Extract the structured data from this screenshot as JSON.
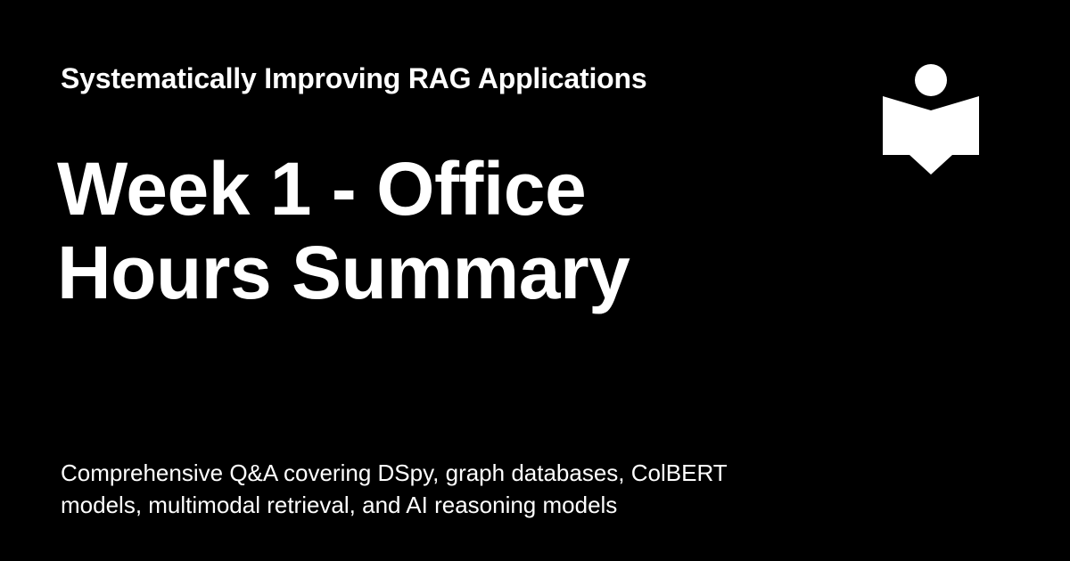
{
  "site": {
    "title": "Systematically Improving RAG Applications"
  },
  "page": {
    "title_lines": [
      "Week 1 - Office",
      "Hours Summary"
    ],
    "description_lines": [
      "Comprehensive Q&A covering DSpy, graph databases, ColBERT",
      "models, multimodal retrieval, and AI reasoning models"
    ]
  },
  "logo": {
    "icon": "reader-book-icon",
    "color": "#ffffff"
  },
  "colors": {
    "background": "#000000",
    "text": "#ffffff"
  }
}
